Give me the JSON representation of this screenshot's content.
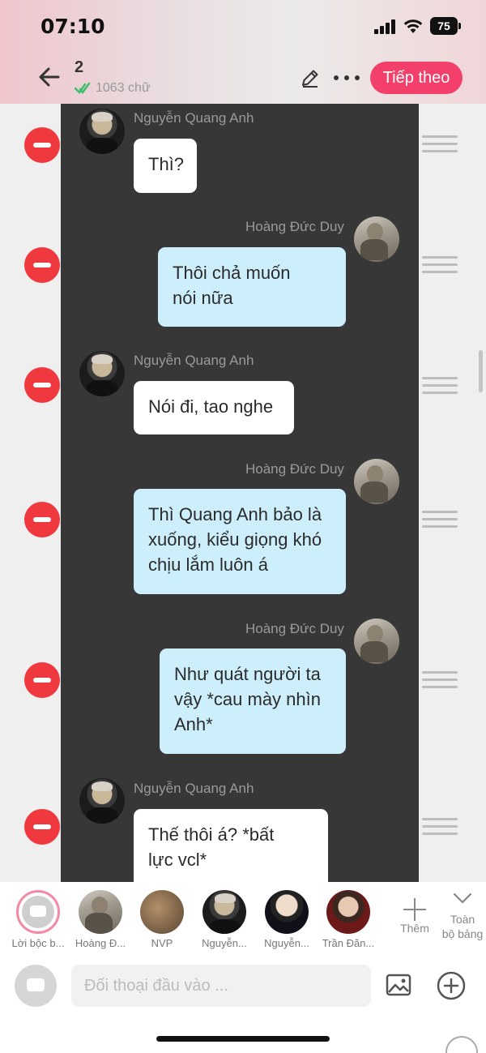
{
  "status_bar": {
    "time": "07:10",
    "battery": "75"
  },
  "header": {
    "chapter_number": "2",
    "word_count": "1063 chữ",
    "next_label": "Tiếp theo"
  },
  "messages": [
    {
      "speaker": "Nguyễn Quang Anh",
      "side": "left",
      "lines": [
        "Thì?"
      ]
    },
    {
      "speaker": "Hoàng Đức Duy",
      "side": "right",
      "lines": [
        "Thôi chả muốn",
        "nói nữa"
      ]
    },
    {
      "speaker": "Nguyễn Quang Anh",
      "side": "left",
      "lines": [
        "Nói đi, tao nghe"
      ]
    },
    {
      "speaker": "Hoàng Đức Duy",
      "side": "right",
      "lines": [
        "Thì Quang Anh bảo là",
        "xuống, kiểu giọng khó",
        "chịu lắm luôn á"
      ]
    },
    {
      "speaker": "Hoàng Đức Duy",
      "side": "right",
      "lines": [
        "Như quát người ta",
        "vậy *cau mày nhìn",
        "Anh*"
      ]
    },
    {
      "speaker": "Nguyễn Quang Anh",
      "side": "left",
      "lines": [
        "Thế thôi á? *bất",
        "lực vcl*"
      ]
    }
  ],
  "characters": [
    {
      "name": "Lời bộc b..."
    },
    {
      "name": "Hoàng Đ..."
    },
    {
      "name": "NVP"
    },
    {
      "name": "Nguyễn..."
    },
    {
      "name": "Nguyễn..."
    },
    {
      "name": "Trần Đăn..."
    }
  ],
  "char_actions": {
    "add_label": "Thêm",
    "whole_label_1": "Toàn",
    "whole_label_2": "bộ bảng"
  },
  "input": {
    "placeholder": "Đối thoại đầu vào ..."
  },
  "colors": {
    "accent": "#f2406a",
    "delete": "#f0393f",
    "bubble_right": "#cdeffc",
    "panel": "#373737"
  }
}
